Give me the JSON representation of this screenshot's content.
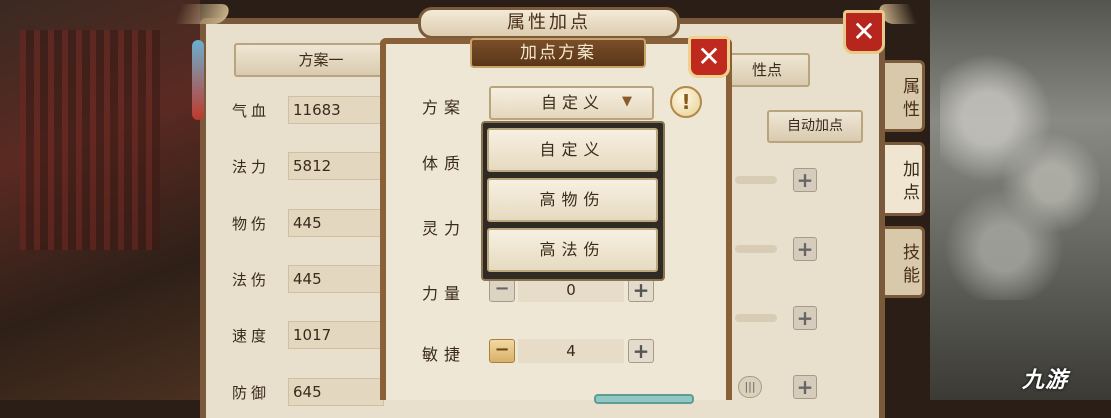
{
  "base_panel": {
    "title": "属性加点",
    "plan_button": "方案一",
    "attr_button_partial": "性点",
    "auto_button": "自动加点",
    "stats": [
      {
        "label": "气血",
        "value": "11683"
      },
      {
        "label": "法力",
        "value": "5812"
      },
      {
        "label": "物伤",
        "value": "445"
      },
      {
        "label": "法伤",
        "value": "445"
      },
      {
        "label": "速度",
        "value": "1017"
      },
      {
        "label": "防御",
        "value": "645"
      }
    ],
    "side_tabs": [
      {
        "label": "属性",
        "active": false
      },
      {
        "label": "加点",
        "active": true
      },
      {
        "label": "技能",
        "active": false
      }
    ],
    "close_glyph": "✕"
  },
  "dialog": {
    "title": "加点方案",
    "close_glyph": "✕",
    "scheme_label": "方案",
    "selected_scheme": "自定义",
    "dropdown_arrow": "▼",
    "warn_glyph": "!",
    "dropdown_options": [
      "自定义",
      "高物伤",
      "高法伤"
    ],
    "rows": [
      {
        "label": "体质"
      },
      {
        "label": "灵力"
      },
      {
        "label": "力量",
        "value": "0"
      },
      {
        "label": "敏捷",
        "value": "4"
      }
    ],
    "minus_glyph": "−",
    "plus_glyph": "+"
  },
  "watermark": "九游",
  "colors": {
    "panel_bg": "#e9dfcd",
    "panel_border": "#7a5a3a",
    "close_red": "#c02a1e",
    "title_plate": "#6a4222",
    "dropdown_bg": "#2f2a24"
  }
}
